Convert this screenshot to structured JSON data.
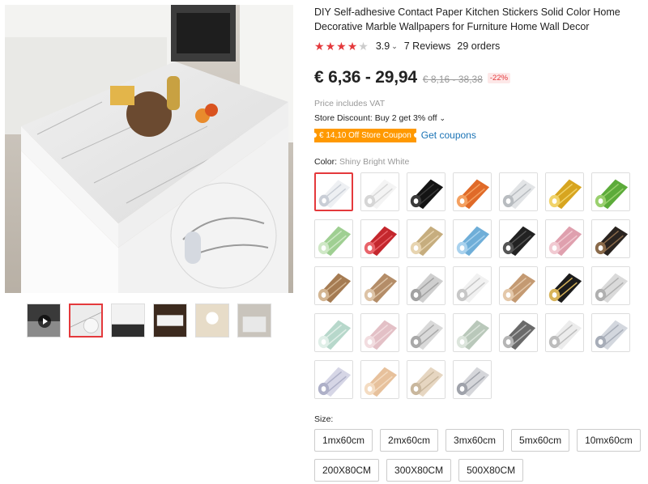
{
  "product": {
    "title": "DIY Self-adhesive Contact Paper Kitchen Stickers Solid Color Home Decorative Marble Wallpapers for Furniture Home Wall Decor",
    "rating": "3.9",
    "rating_stars": 4,
    "reviews": "7 Reviews",
    "orders": "29 orders"
  },
  "price": {
    "current": "€ 6,36 - 29,94",
    "original": "€ 8,16 - 38,38",
    "discount": "-22%",
    "vat_note": "Price includes VAT",
    "store_discount": "Store Discount: Buy 2 get 3% off",
    "coupon": "€ 14,10 Off Store Coupon",
    "get_coupons": "Get coupons"
  },
  "gallery": {
    "main_image_alt": "marble contact paper kitchen island",
    "thumbnails": [
      "video-thumb",
      "marble-roll",
      "white-counter",
      "dark-table",
      "beige-table",
      "grey-room"
    ],
    "active_thumbnail": 1
  },
  "color": {
    "label": "Color:",
    "selected": "Shiny Bright White",
    "swatches": [
      {
        "name": "shiny-bright-white",
        "color": "#eef0f3",
        "accent": "#c9ced6"
      },
      {
        "name": "white",
        "color": "#f4f4f4",
        "accent": "#d6d6d6"
      },
      {
        "name": "black",
        "color": "#141414",
        "accent": "#3a3a3a"
      },
      {
        "name": "orange",
        "color": "#e06a28",
        "accent": "#f4a060"
      },
      {
        "name": "silver",
        "color": "#e2e4e6",
        "accent": "#b8bcc0"
      },
      {
        "name": "gold",
        "color": "#d7a520",
        "accent": "#f1d36a"
      },
      {
        "name": "green",
        "color": "#5cab3a",
        "accent": "#9ad06e"
      },
      {
        "name": "light-green",
        "color": "#9fcf92",
        "accent": "#cfe8c6"
      },
      {
        "name": "red",
        "color": "#c4272d",
        "accent": "#e9646a"
      },
      {
        "name": "champagne-gold",
        "color": "#c6ad7e",
        "accent": "#e7d4b0"
      },
      {
        "name": "sky-blue",
        "color": "#6faed8",
        "accent": "#a9d2ee"
      },
      {
        "name": "glossy-black",
        "color": "#222222",
        "accent": "#555555"
      },
      {
        "name": "pink",
        "color": "#dfa0ae",
        "accent": "#f1cad2"
      },
      {
        "name": "black-marble",
        "color": "#2a2420",
        "accent": "#8a6a4a"
      },
      {
        "name": "brown-marble",
        "color": "#a57b52",
        "accent": "#d3b592"
      },
      {
        "name": "tan-marble",
        "color": "#b48d68",
        "accent": "#ddc3a6"
      },
      {
        "name": "grey-marble",
        "color": "#cfcfcf",
        "accent": "#a2a2a2"
      },
      {
        "name": "white-marble",
        "color": "#f1f1f1",
        "accent": "#c7c7c7"
      },
      {
        "name": "beige-marble",
        "color": "#c49a72",
        "accent": "#e4c8aa"
      },
      {
        "name": "black-gold-marble",
        "color": "#1c1c1c",
        "accent": "#d8b45a"
      },
      {
        "name": "light-grey-marble",
        "color": "#dadada",
        "accent": "#b0b0b0"
      },
      {
        "name": "mint-marble",
        "color": "#b7d8cb",
        "accent": "#e0efe8"
      },
      {
        "name": "pink-marble",
        "color": "#e3c0c6",
        "accent": "#f2dde0"
      },
      {
        "name": "soft-grey-marble",
        "color": "#d9d9d9",
        "accent": "#a9a9a9"
      },
      {
        "name": "sage-marble",
        "color": "#b9c8ba",
        "accent": "#dce5dc"
      },
      {
        "name": "dark-grey-marble",
        "color": "#6a6a6a",
        "accent": "#b5b5b5"
      },
      {
        "name": "pearl-marble",
        "color": "#ececec",
        "accent": "#bdbdbd"
      },
      {
        "name": "blue-grey-marble",
        "color": "#d3d7de",
        "accent": "#a7adb8"
      },
      {
        "name": "lavender-marble",
        "color": "#d6d6e6",
        "accent": "#aeb0c8"
      },
      {
        "name": "peach-marble",
        "color": "#e7c19c",
        "accent": "#f4dcc2"
      },
      {
        "name": "cream-marble",
        "color": "#e6d6c1",
        "accent": "#c9b79d"
      },
      {
        "name": "cool-grey-marble",
        "color": "#d5d6da",
        "accent": "#9fa2aa"
      }
    ]
  },
  "size": {
    "label": "Size:",
    "rows": [
      [
        "1mx60cm",
        "2mx60cm",
        "3mx60cm",
        "5mx60cm",
        "10mx60cm"
      ],
      [
        "200X80CM",
        "300X80CM",
        "500X80CM"
      ]
    ]
  },
  "colors": {
    "accent": "#e4393c",
    "coupon": "#ff9900",
    "link": "#1a73b5"
  }
}
